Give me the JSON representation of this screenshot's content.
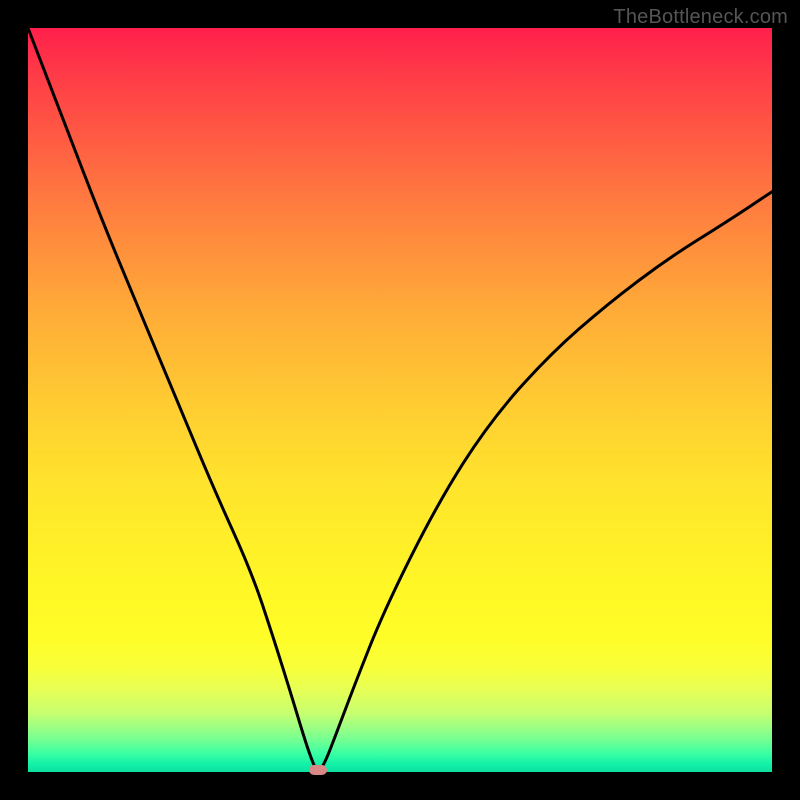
{
  "watermark": "TheBottleneck.com",
  "chart_data": {
    "type": "line",
    "title": "",
    "xlabel": "",
    "ylabel": "",
    "xlim": [
      0,
      100
    ],
    "ylim": [
      0,
      100
    ],
    "grid": false,
    "legend": false,
    "series": [
      {
        "name": "bottleneck-curve",
        "x": [
          0,
          5,
          10,
          15,
          20,
          25,
          30,
          33,
          35.5,
          37,
          38,
          38.7,
          39.3,
          40,
          41,
          44,
          48,
          55,
          62,
          70,
          78,
          86,
          94,
          100
        ],
        "y": [
          100,
          87,
          74,
          62,
          50,
          38,
          27,
          18,
          10,
          5,
          2,
          0.3,
          0.3,
          1.5,
          4,
          12,
          22,
          36,
          47,
          56,
          63,
          69,
          74,
          78
        ]
      }
    ],
    "marker": {
      "x_pct": 39,
      "y_pct": 0.2,
      "color": "#d98888"
    },
    "gradient_stops": [
      {
        "pos": 0,
        "color": "#ff1f4b"
      },
      {
        "pos": 0.5,
        "color": "#ffd430"
      },
      {
        "pos": 0.82,
        "color": "#fffd28"
      },
      {
        "pos": 1.0,
        "color": "#0ce0a0"
      }
    ]
  }
}
